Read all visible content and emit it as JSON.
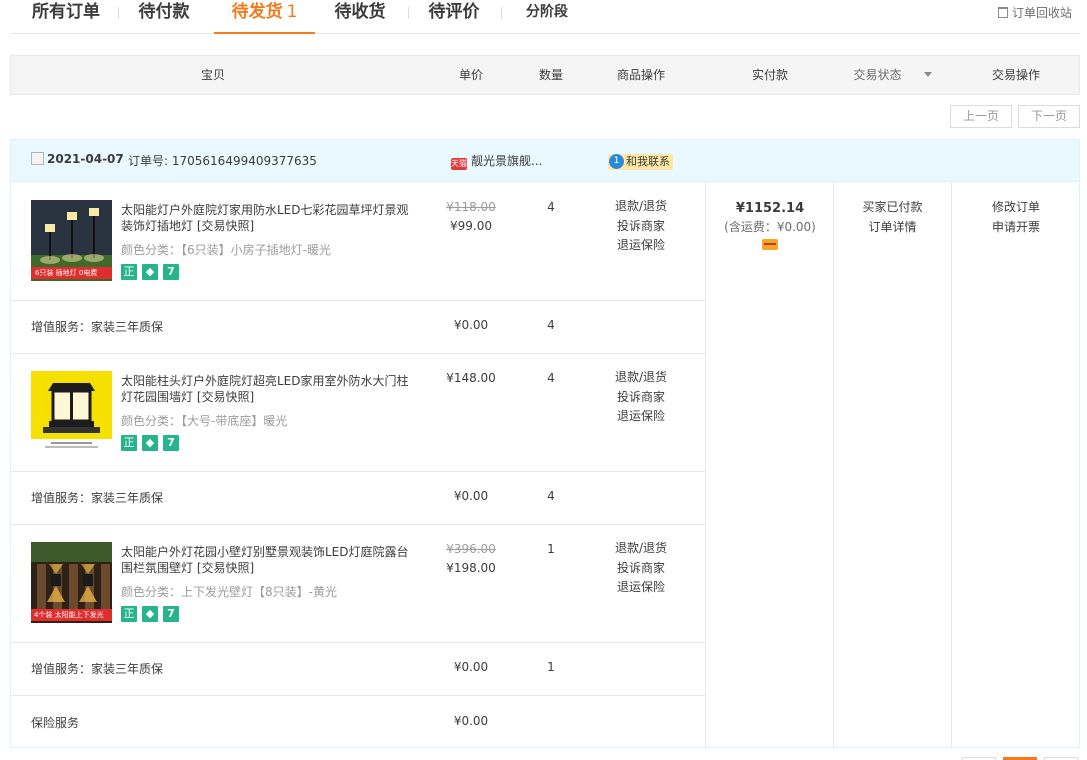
{
  "tabs": [
    {
      "label": "所有订单",
      "count": ""
    },
    {
      "label": "待付款",
      "count": ""
    },
    {
      "label": "待发货",
      "count": "1"
    },
    {
      "label": "待收货",
      "count": ""
    },
    {
      "label": "待评价",
      "count": ""
    },
    {
      "label": "分阶段",
      "count": ""
    }
  ],
  "recycle_label": "订单回收站",
  "columns": {
    "item": "宝贝",
    "price": "单价",
    "qty": "数量",
    "item_ops": "商品操作",
    "paid": "实付款",
    "status": "交易状态",
    "actions": "交易操作"
  },
  "pager": {
    "prev": "上一页",
    "next": "下一页"
  },
  "order": {
    "date": "2021-04-07",
    "number_label": "订单号:",
    "number": "1705616499409377635",
    "shop_icon_text": "天猫",
    "shop": "靓光景旗舰...",
    "contact": "和我联系",
    "contact_icon_text": "1",
    "items": [
      {
        "title": "太阳能灯户外庭院灯家用防水LED七彩花园草坪灯景观装饰灯插地灯 [交易快照]",
        "spec": "颜色分类：【6只装】小房子插地灯-暖光",
        "image_caption": "6只装 插地灯 0电费",
        "original_price": "¥118.00",
        "price": "¥99.00",
        "qty": "4",
        "ops": [
          "退款/退货",
          "投诉商家",
          "退运保险"
        ],
        "service": {
          "label": "增值服务：家装三年质保",
          "price": "¥0.00",
          "qty": "4"
        }
      },
      {
        "title": "太阳能柱头灯户外庭院灯超亮LED家用室外防水大门柱灯花园围墙灯 [交易快照]",
        "spec": "颜色分类：【大号-带底座】暖光",
        "image_caption": "",
        "original_price": "",
        "price": "¥148.00",
        "qty": "4",
        "ops": [
          "退款/退货",
          "投诉商家",
          "退运保险"
        ],
        "service": {
          "label": "增值服务：家装三年质保",
          "price": "¥0.00",
          "qty": "4"
        }
      },
      {
        "title": "太阳能户外灯花园小壁灯别墅景观装饰LED灯庭院露台围栏氛围壁灯 [交易快照]",
        "spec": "颜色分类：上下发光壁灯【8只装】-黄光",
        "image_caption": "4个装 太阳能上下发光",
        "original_price": "¥396.00",
        "price": "¥198.00",
        "qty": "1",
        "ops": [
          "退款/退货",
          "投诉商家",
          "退运保险"
        ],
        "service": {
          "label": "增值服务：家装三年质保",
          "price": "¥0.00",
          "qty": "1"
        }
      }
    ],
    "insurance": {
      "label": "保险服务",
      "price": "¥0.00"
    },
    "badges": [
      "正",
      "◆",
      "7"
    ],
    "paid": {
      "amount": "¥1152.14",
      "shipping": "(含运费：¥0.00)"
    },
    "status": [
      "买家已付款",
      "订单详情"
    ],
    "actions": [
      "修改订单",
      "申请开票"
    ]
  },
  "colors": {
    "accent": "#f37b1d",
    "header_bg": "#f5f5f5",
    "order_head_bg": "#eaf8ff",
    "badge": "#25b48c"
  }
}
